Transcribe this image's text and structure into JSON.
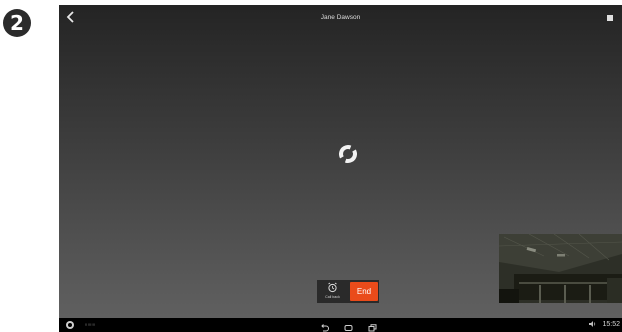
{
  "step": {
    "number": "2"
  },
  "call": {
    "caller_name": "Jane Dawson",
    "state": "connecting"
  },
  "controls": {
    "callback_label": "Call back",
    "end_label": "End"
  },
  "system_bar": {
    "left_text": "!!!!!!!!",
    "time": "15:52"
  },
  "icons": {
    "back": "back-arrow-icon",
    "menu": "grid-menu-icon",
    "spinner": "loading-spinner-icon",
    "callback": "alarm-clock-icon",
    "nav_back": "back-icon",
    "nav_home": "home-icon",
    "nav_recents": "recent-apps-icon",
    "volume": "volume-icon"
  },
  "colors": {
    "end_button": "#ea4b1a",
    "background_top": "#242424",
    "background_bottom": "#636363"
  }
}
